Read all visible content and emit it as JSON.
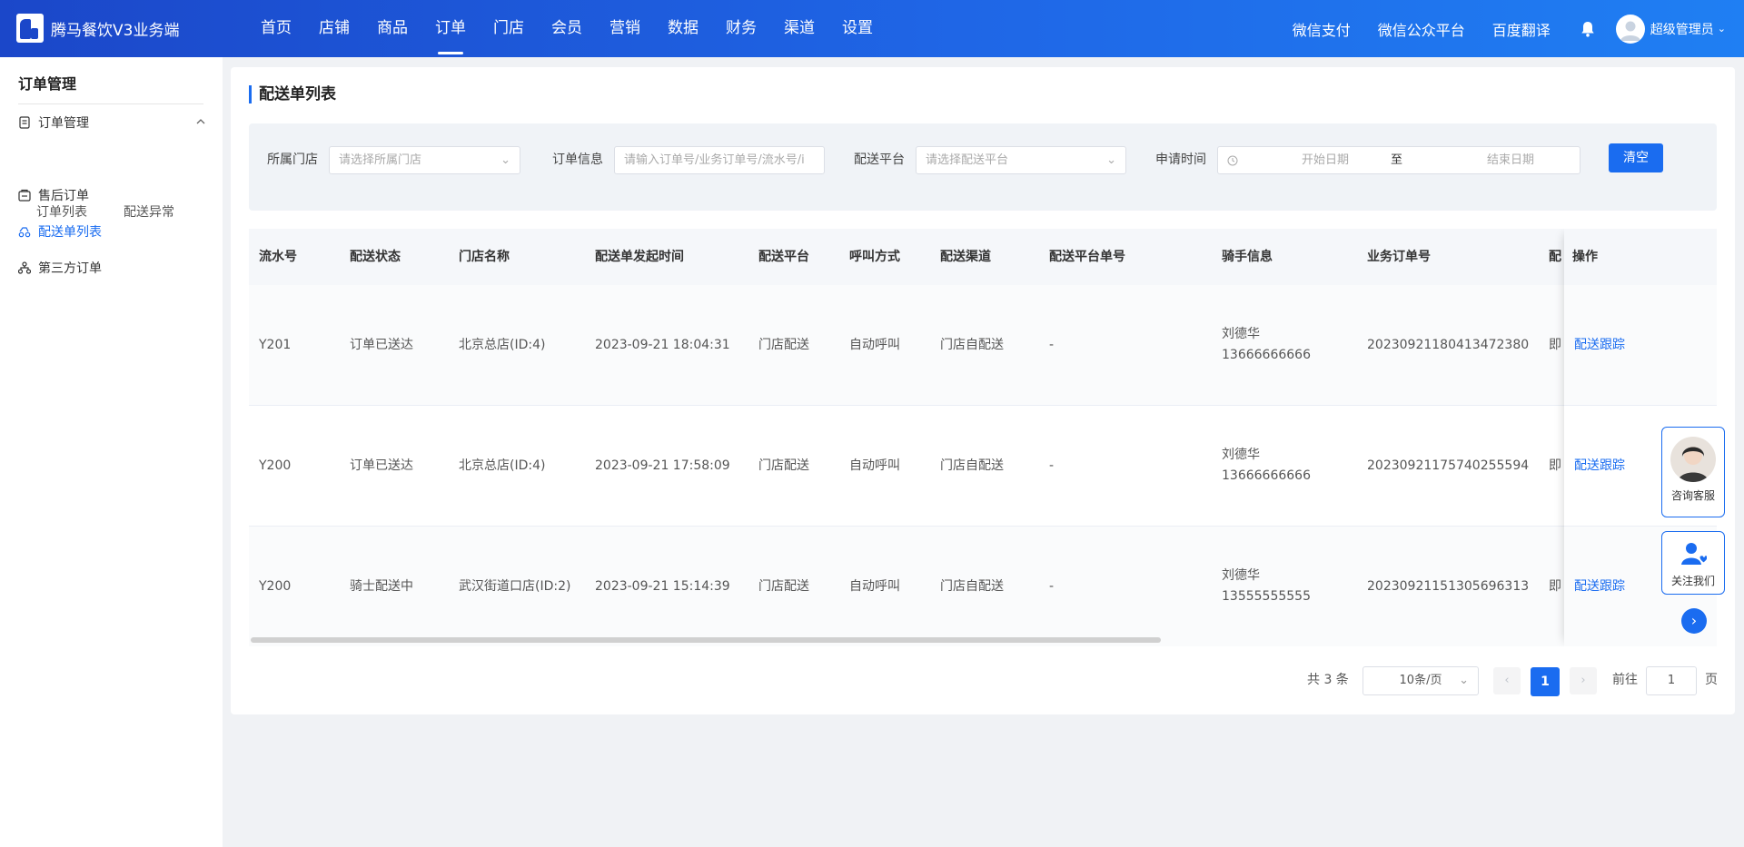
{
  "header": {
    "logo_text": "腾马餐饮V3业务端",
    "nav": [
      "首页",
      "店铺",
      "商品",
      "订单",
      "门店",
      "会员",
      "营销",
      "数据",
      "财务",
      "渠道",
      "设置"
    ],
    "active_nav": "订单",
    "right_links": [
      "微信支付",
      "微信公众平台",
      "百度翻译"
    ],
    "user_name": "超级管理员"
  },
  "sidebar": {
    "title": "订单管理",
    "group": "订单管理",
    "sub_items": [
      "订单列表",
      "配送异常"
    ],
    "items": [
      "售后订单",
      "配送单列表",
      "第三方订单"
    ],
    "active_item": "配送单列表"
  },
  "page": {
    "title": "配送单列表"
  },
  "filters": {
    "store_label": "所属门店",
    "store_placeholder": "请选择所属门店",
    "order_label": "订单信息",
    "order_placeholder": "请输入订单号/业务订单号/流水号/i",
    "platform_label": "配送平台",
    "platform_placeholder": "请选择配送平台",
    "time_label": "申请时间",
    "start_placeholder": "开始日期",
    "range_sep": "至",
    "end_placeholder": "结束日期",
    "clear_button": "清空"
  },
  "table": {
    "columns": [
      "流水号",
      "配送状态",
      "门店名称",
      "配送单发起时间",
      "配送平台",
      "呼叫方式",
      "配送渠道",
      "配送平台单号",
      "骑手信息",
      "业务订单号",
      "配",
      "操作"
    ],
    "rows": [
      {
        "serial": "Y201",
        "status": "订单已送达",
        "store": "北京总店(ID:4)",
        "time": "2023-09-21 18:04:31",
        "platform": "门店配送",
        "call": "自动呼叫",
        "channel": "门店自配送",
        "platform_no": "-",
        "rider_name": "刘德华",
        "rider_phone": "13666666666",
        "order_no": "20230921180413472380",
        "partial": "即",
        "action": "配送跟踪"
      },
      {
        "serial": "Y200",
        "status": "订单已送达",
        "store": "北京总店(ID:4)",
        "time": "2023-09-21 17:58:09",
        "platform": "门店配送",
        "call": "自动呼叫",
        "channel": "门店自配送",
        "platform_no": "-",
        "rider_name": "刘德华",
        "rider_phone": "13666666666",
        "order_no": "20230921175740255594",
        "partial": "即",
        "action": "配送跟踪"
      },
      {
        "serial": "Y200",
        "status": "骑士配送中",
        "store": "武汉街道口店(ID:2)",
        "time": "2023-09-21 15:14:39",
        "platform": "门店配送",
        "call": "自动呼叫",
        "channel": "门店自配送",
        "platform_no": "-",
        "rider_name": "刘德华",
        "rider_phone": "13555555555",
        "order_no": "20230921151305696313",
        "partial": "即",
        "action": "配送跟踪"
      }
    ]
  },
  "pagination": {
    "total": "共 3 条",
    "page_size": "10条/页",
    "current_page": "1",
    "goto_label": "前往",
    "goto_value": "1",
    "page_unit": "页"
  },
  "floating": {
    "consult_label": "咨询客服",
    "follow_label": "关注我们"
  },
  "colors": {
    "primary": "#1a6cf0",
    "header_start": "#1b47c9",
    "header_end": "#1f7ff3"
  },
  "icons": [
    "logo-icon",
    "bell-icon",
    "avatar-icon",
    "chevron-down-icon",
    "order-doc-icon",
    "chevron-up-icon",
    "after-sale-icon",
    "delivery-icon",
    "third-party-icon",
    "clock-icon",
    "chevron-left-icon",
    "chevron-right-icon",
    "follow-user-icon"
  ]
}
